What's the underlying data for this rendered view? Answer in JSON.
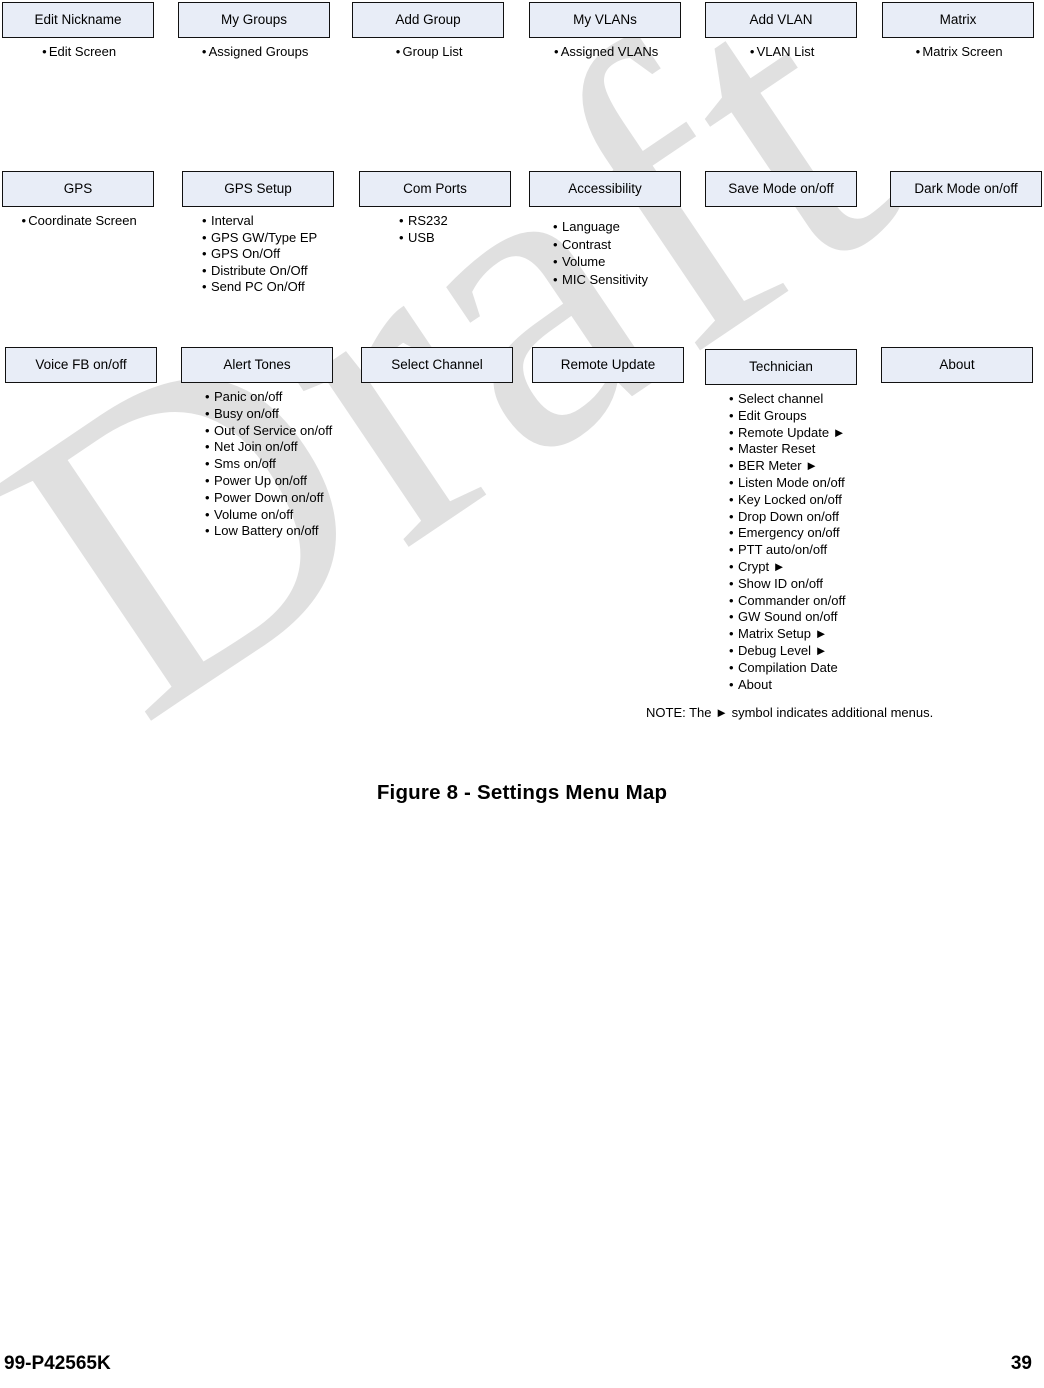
{
  "document": {
    "figure_caption": "Figure 8 - Settings Menu Map",
    "note": "NOTE: The ► symbol indicates additional menus.",
    "footer_doc_number": "99-P42565K",
    "footer_page_number": "39",
    "watermark_text": "Draft"
  },
  "theme": {
    "box_fill": "#e8edf7",
    "box_border": "#111111",
    "text_color": "#000000",
    "watermark_color": "#e0e0e0"
  },
  "rows": [
    {
      "id": "row-1",
      "columns": [
        {
          "id": "edit-nickname",
          "title": "Edit Nickname",
          "items": [
            "Edit Screen"
          ]
        },
        {
          "id": "my-groups",
          "title": "My Groups",
          "items": [
            "Assigned Groups"
          ]
        },
        {
          "id": "add-group",
          "title": "Add Group",
          "items": [
            "Group List"
          ]
        },
        {
          "id": "my-vlans",
          "title": "My VLANs",
          "items": [
            "Assigned VLANs"
          ]
        },
        {
          "id": "add-vlan",
          "title": "Add VLAN",
          "items": [
            "VLAN List"
          ]
        },
        {
          "id": "matrix",
          "title": "Matrix",
          "items": [
            "Matrix Screen"
          ]
        }
      ]
    },
    {
      "id": "row-2",
      "columns": [
        {
          "id": "gps",
          "title": "GPS",
          "items": [
            "Coordinate Screen"
          ]
        },
        {
          "id": "gps-setup",
          "title": "GPS Setup",
          "items": [
            "Interval",
            "GPS GW/Type EP",
            "GPS On/Off",
            "Distribute On/Off",
            "Send PC On/Off"
          ]
        },
        {
          "id": "com-ports",
          "title": "Com Ports",
          "items": [
            "RS232",
            "USB"
          ]
        },
        {
          "id": "accessibility",
          "title": "Accessibility",
          "items": [
            "Language",
            "Contrast",
            "Volume",
            "MIC Sensitivity"
          ]
        },
        {
          "id": "save-mode",
          "title": "Save Mode on/off",
          "items": []
        },
        {
          "id": "dark-mode",
          "title": "Dark Mode on/off",
          "items": []
        }
      ]
    },
    {
      "id": "row-3",
      "columns": [
        {
          "id": "voice-fb",
          "title": "Voice FB on/off",
          "items": []
        },
        {
          "id": "alert-tones",
          "title": "Alert Tones",
          "items": [
            "Panic on/off",
            "Busy on/off",
            "Out of Service on/off",
            "Net Join on/off",
            "Sms on/off",
            "Power Up on/off",
            "Power Down on/off",
            "Volume on/off",
            "Low Battery on/off"
          ]
        },
        {
          "id": "select-channel",
          "title": "Select Channel",
          "items": []
        },
        {
          "id": "remote-update",
          "title": "Remote Update",
          "items": []
        },
        {
          "id": "technician",
          "title": "Technician",
          "items": [
            "Select channel",
            "Edit Groups",
            "Remote Update ►",
            "Master Reset",
            "BER Meter ►",
            "Listen Mode on/off",
            "Key Locked on/off",
            "Drop Down on/off",
            "Emergency on/off",
            "PTT auto/on/off",
            "Crypt ►",
            "Show ID on/off",
            "Commander on/off",
            "GW Sound on/off",
            "Matrix Setup ►",
            "Debug Level ►",
            "Compilation Date",
            "About"
          ]
        },
        {
          "id": "about",
          "title": "About",
          "items": []
        }
      ]
    }
  ]
}
